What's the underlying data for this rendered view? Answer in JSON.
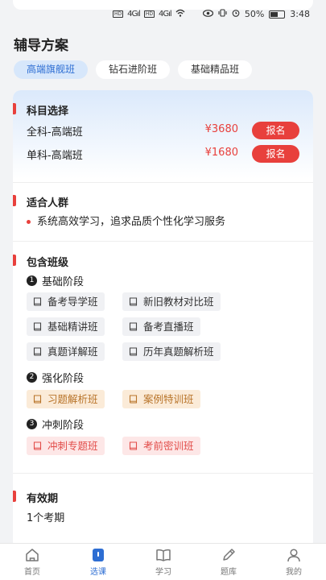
{
  "status_bar": {
    "left_badges": [
      "HD",
      "HD"
    ],
    "signal_labels": [
      "4G",
      "4G"
    ],
    "battery_percent": "50%",
    "time": "3:48"
  },
  "page_title": "辅导方案",
  "tabs": [
    {
      "label": "高端旗舰班",
      "active": true
    },
    {
      "label": "钻石进阶班",
      "active": false
    },
    {
      "label": "基础精品班",
      "active": false
    }
  ],
  "subject": {
    "title": "科目选择",
    "options": [
      {
        "name": "全科-高端班",
        "price": "¥3680",
        "button": "报名"
      },
      {
        "name": "单科-高端班",
        "price": "¥1680",
        "button": "报名"
      }
    ]
  },
  "audience": {
    "title": "适合人群",
    "text": "系统高效学习，追求品质个性化学习服务"
  },
  "classes": {
    "title": "包含班级",
    "stages": [
      {
        "num": "1",
        "label": "基础阶段",
        "items": [
          "备考导学班",
          "新旧教材对比班",
          "基础精讲班",
          "备考直播班",
          "真题详解班",
          "历年真题解析班"
        ]
      },
      {
        "num": "2",
        "label": "强化阶段",
        "items": [
          "习题解析班",
          "案例特训班"
        ]
      },
      {
        "num": "3",
        "label": "冲刺阶段",
        "items": [
          "冲刺专题班",
          "考前密训班"
        ]
      }
    ]
  },
  "validity": {
    "title": "有效期",
    "text": "1个考期"
  },
  "colors": {
    "accent_red": "#e8403c",
    "accent_blue": "#2d6ed3"
  },
  "nav": [
    {
      "label": "首页",
      "icon": "home-icon",
      "active": false
    },
    {
      "label": "选课",
      "icon": "course-icon",
      "active": true
    },
    {
      "label": "学习",
      "icon": "book-open-icon",
      "active": false
    },
    {
      "label": "题库",
      "icon": "pencil-icon",
      "active": false
    },
    {
      "label": "我的",
      "icon": "user-icon",
      "active": false
    }
  ]
}
